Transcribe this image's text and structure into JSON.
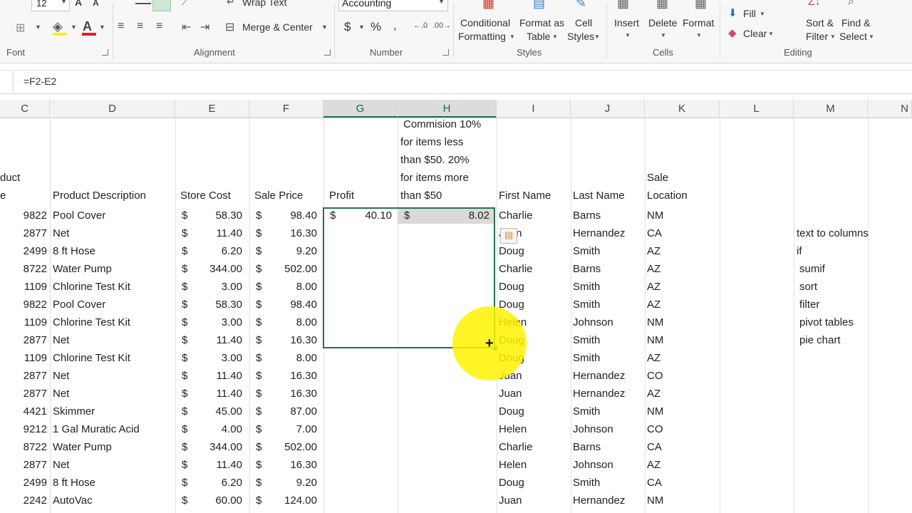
{
  "ribbon": {
    "font_size": "12",
    "wrap_text": "Wrap Text",
    "merge_center": "Merge & Center",
    "number_format": "Accounting",
    "currency": "$",
    "percent": "%",
    "comma": ",",
    "cond_format": [
      "Conditional",
      "Formatting"
    ],
    "format_table": [
      "Format as",
      "Table"
    ],
    "cell_styles": [
      "Cell",
      "Styles"
    ],
    "insert": "Insert",
    "delete": "Delete",
    "format": "Format",
    "fill": "Fill",
    "clear": "Clear",
    "sort_filter": [
      "Sort &",
      "Filter"
    ],
    "find_select": [
      "Find &",
      "Select"
    ],
    "groups": {
      "font": "Font",
      "alignment": "Alignment",
      "number": "Number",
      "styles": "Styles",
      "cells": "Cells",
      "editing": "Editing"
    },
    "accent": "#217346"
  },
  "formula_bar": {
    "formula": "=F2-E2"
  },
  "columns": [
    "C",
    "D",
    "E",
    "F",
    "G",
    "H",
    "I",
    "J",
    "K",
    "L",
    "M",
    "N"
  ],
  "header_row": {
    "c_lines": [
      "duct",
      "e"
    ],
    "d": "Product Description",
    "e": "Store Cost",
    "f": "Sale Price",
    "g": "Profit",
    "h_lines": [
      "Commision 10%",
      "for items less",
      "than $50. 20%",
      "for items more",
      "than $50"
    ],
    "i": "First Name",
    "j": "Last Name",
    "k_lines": [
      "Sale",
      "Location"
    ]
  },
  "rows": [
    {
      "c": "9822",
      "d": "Pool Cover",
      "e": "58.30",
      "f": "98.40",
      "i": "Charlie",
      "j": "Barns",
      "k": "NM"
    },
    {
      "c": "2877",
      "d": "Net",
      "e": "11.40",
      "f": "16.30",
      "i": "Juan",
      "j": "Hernandez",
      "k": "CA"
    },
    {
      "c": "2499",
      "d": "8 ft Hose",
      "e": "6.20",
      "f": "9.20",
      "i": "Doug",
      "j": "Smith",
      "k": "AZ"
    },
    {
      "c": "8722",
      "d": "Water Pump",
      "e": "344.00",
      "f": "502.00",
      "i": "Charlie",
      "j": "Barns",
      "k": "AZ"
    },
    {
      "c": "1109",
      "d": "Chlorine Test Kit",
      "e": "3.00",
      "f": "8.00",
      "i": "Doug",
      "j": "Smith",
      "k": "AZ"
    },
    {
      "c": "9822",
      "d": "Pool Cover",
      "e": "58.30",
      "f": "98.40",
      "i": "Doug",
      "j": "Smith",
      "k": "AZ"
    },
    {
      "c": "1109",
      "d": "Chlorine Test Kit",
      "e": "3.00",
      "f": "8.00",
      "i": "Helen",
      "j": "Johnson",
      "k": "NM"
    },
    {
      "c": "2877",
      "d": "Net",
      "e": "11.40",
      "f": "16.30",
      "i": "Doug",
      "j": "Smith",
      "k": "NM"
    },
    {
      "c": "1109",
      "d": "Chlorine Test Kit",
      "e": "3.00",
      "f": "8.00",
      "i": "Doug",
      "j": "Smith",
      "k": "AZ"
    },
    {
      "c": "2877",
      "d": "Net",
      "e": "11.40",
      "f": "16.30",
      "i": "Juan",
      "j": "Hernandez",
      "k": "CO"
    },
    {
      "c": "2877",
      "d": "Net",
      "e": "11.40",
      "f": "16.30",
      "i": "Juan",
      "j": "Hernandez",
      "k": "AZ"
    },
    {
      "c": "4421",
      "d": "Skimmer",
      "e": "45.00",
      "f": "87.00",
      "i": "Doug",
      "j": "Smith",
      "k": "NM"
    },
    {
      "c": "9212",
      "d": "1 Gal Muratic Acid",
      "e": "4.00",
      "f": "7.00",
      "i": "Helen",
      "j": "Johnson",
      "k": "CO"
    },
    {
      "c": "8722",
      "d": "Water Pump",
      "e": "344.00",
      "f": "502.00",
      "i": "Charlie",
      "j": "Barns",
      "k": "CA"
    },
    {
      "c": "2877",
      "d": "Net",
      "e": "11.40",
      "f": "16.30",
      "i": "Helen",
      "j": "Johnson",
      "k": "AZ"
    },
    {
      "c": "2499",
      "d": "8 ft Hose",
      "e": "6.20",
      "f": "9.20",
      "i": "Doug",
      "j": "Smith",
      "k": "CA"
    },
    {
      "c": "2242",
      "d": "AutoVac",
      "e": "60.00",
      "f": "124.00",
      "i": "Juan",
      "j": "Hernandez",
      "k": "NM"
    }
  ],
  "first_row_values": {
    "g": "40.10",
    "h": "8.02"
  },
  "currency_symbol": "$",
  "notes": [
    "text to columns",
    "if",
    "sumif",
    "sort",
    "filter",
    "pivot tables",
    "pie chart"
  ]
}
